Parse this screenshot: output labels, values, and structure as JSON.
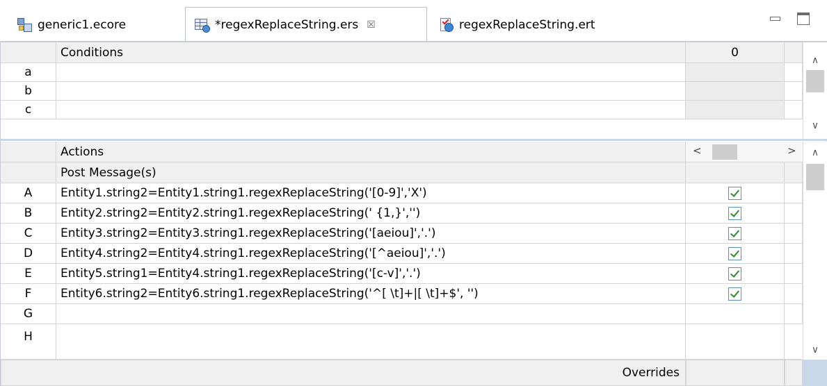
{
  "tabs": [
    {
      "label": "generic1.ecore",
      "icon": "ecore-file-icon",
      "active": false
    },
    {
      "label": "*regexReplaceString.ers",
      "icon": "ers-file-icon",
      "active": true,
      "close": "☒"
    },
    {
      "label": "regexReplaceString.ert",
      "icon": "ert-file-icon",
      "active": false
    }
  ],
  "conditions": {
    "header": "Conditions",
    "column": "0",
    "rows": [
      {
        "id": "a",
        "text": ""
      },
      {
        "id": "b",
        "text": ""
      },
      {
        "id": "c",
        "text": ""
      }
    ]
  },
  "actions": {
    "header": "Actions",
    "subheader": "Post Message(s)",
    "rows": [
      {
        "id": "A",
        "text": "Entity1.string2=Entity1.string1.regexReplaceString('[0-9]','X')",
        "checked": true
      },
      {
        "id": "B",
        "text": "Entity2.string2=Entity2.string1.regexReplaceString(' {1,}','')",
        "checked": true
      },
      {
        "id": "C",
        "text": "Entity3.string2=Entity3.string1.regexReplaceString('[aeiou]','.')",
        "checked": true
      },
      {
        "id": "D",
        "text": "Entity4.string2=Entity4.string1.regexReplaceString('[^aeiou]','.')",
        "checked": true
      },
      {
        "id": "E",
        "text": "Entity5.string1=Entity4.string1.regexReplaceString('[c-v]','.')",
        "checked": true
      },
      {
        "id": "F",
        "text": "Entity6.string2=Entity6.string1.regexReplaceString('^[ \\t]+|[ \\t]+$', '')",
        "checked": true
      },
      {
        "id": "G",
        "text": "",
        "checked": false
      }
    ],
    "partial_row_id": "H"
  },
  "footer": {
    "label": "Overrides"
  },
  "colors": {
    "accent": "#c9d7ea",
    "header_bg": "#f0f0f0",
    "check": "#2e8b2e"
  }
}
